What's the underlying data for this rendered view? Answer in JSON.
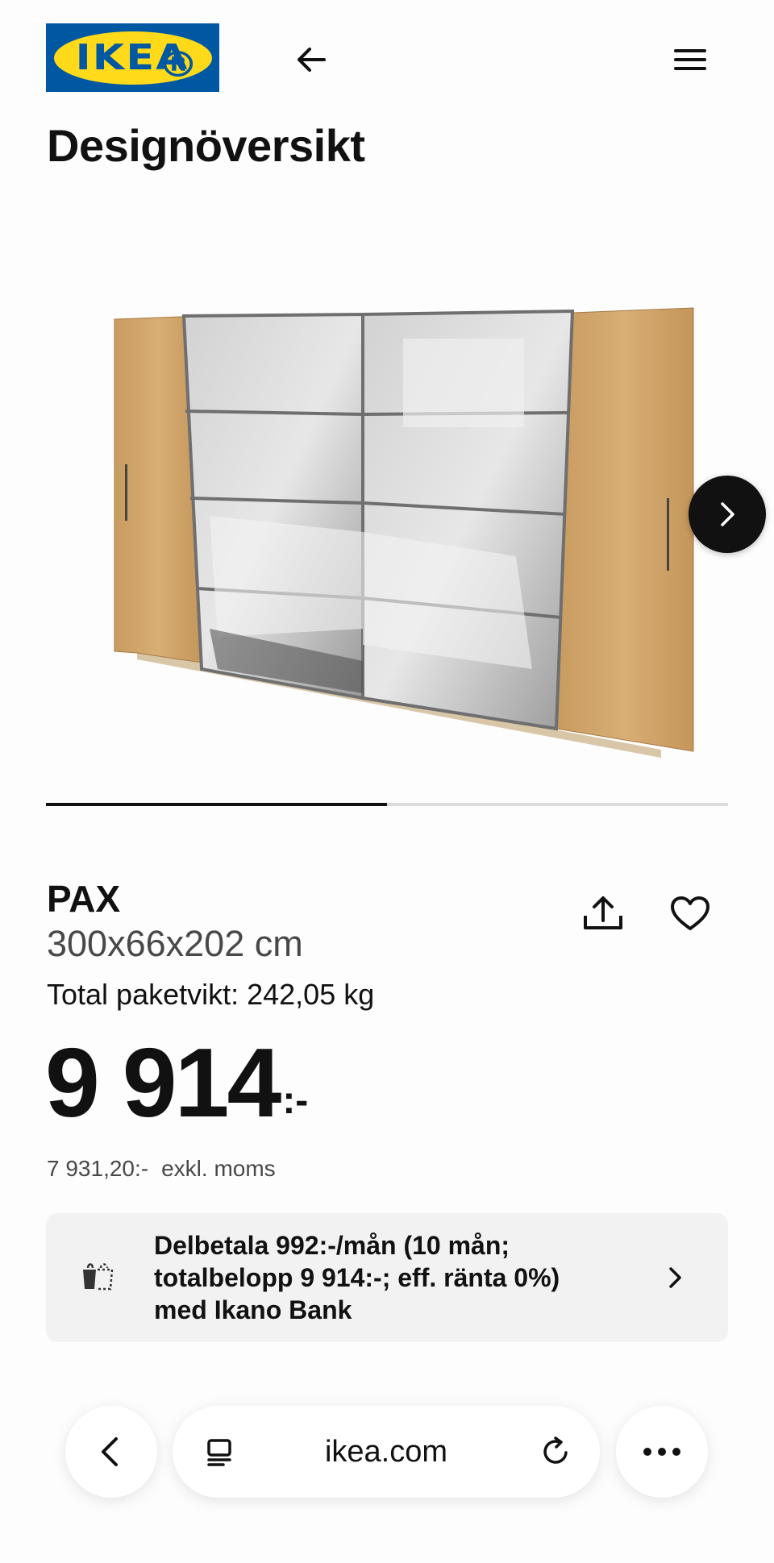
{
  "header": {
    "logo_text": "IKEA",
    "logo_reg": "®",
    "back_icon": "arrow-left-icon",
    "menu_icon": "hamburger-menu-icon",
    "title": "Designöversikt",
    "colors": {
      "logo_blue": "#0058a3",
      "logo_yellow": "#ffda1a"
    }
  },
  "gallery": {
    "image": "wardrobe-image",
    "next_icon": "chevron-right-icon",
    "progress_fraction": 0.5
  },
  "product": {
    "name": "PAX",
    "size": "300x66x202 cm",
    "weight": "Total paketvikt: 242,05 kg",
    "price_integer": "9 914",
    "price_suffix": ":-",
    "price_excl_value": "7 931,20:-",
    "price_excl_label": "exkl. moms",
    "share_icon": "share-icon",
    "favorite_icon": "heart-icon"
  },
  "financing": {
    "icon": "payment-icon",
    "line1": "Delbetala 992:-/mån (10 mån;",
    "line2": "totalbelopp 9 914:-; eff. ränta 0%)",
    "line3": "med Ikano Bank",
    "chevron_icon": "chevron-right-icon"
  },
  "browser": {
    "back_icon": "chevron-left-icon",
    "tabs_icon": "tabs-icon",
    "url": "ikea.com",
    "reload_icon": "reload-icon",
    "more_icon": "more-dots-icon"
  }
}
